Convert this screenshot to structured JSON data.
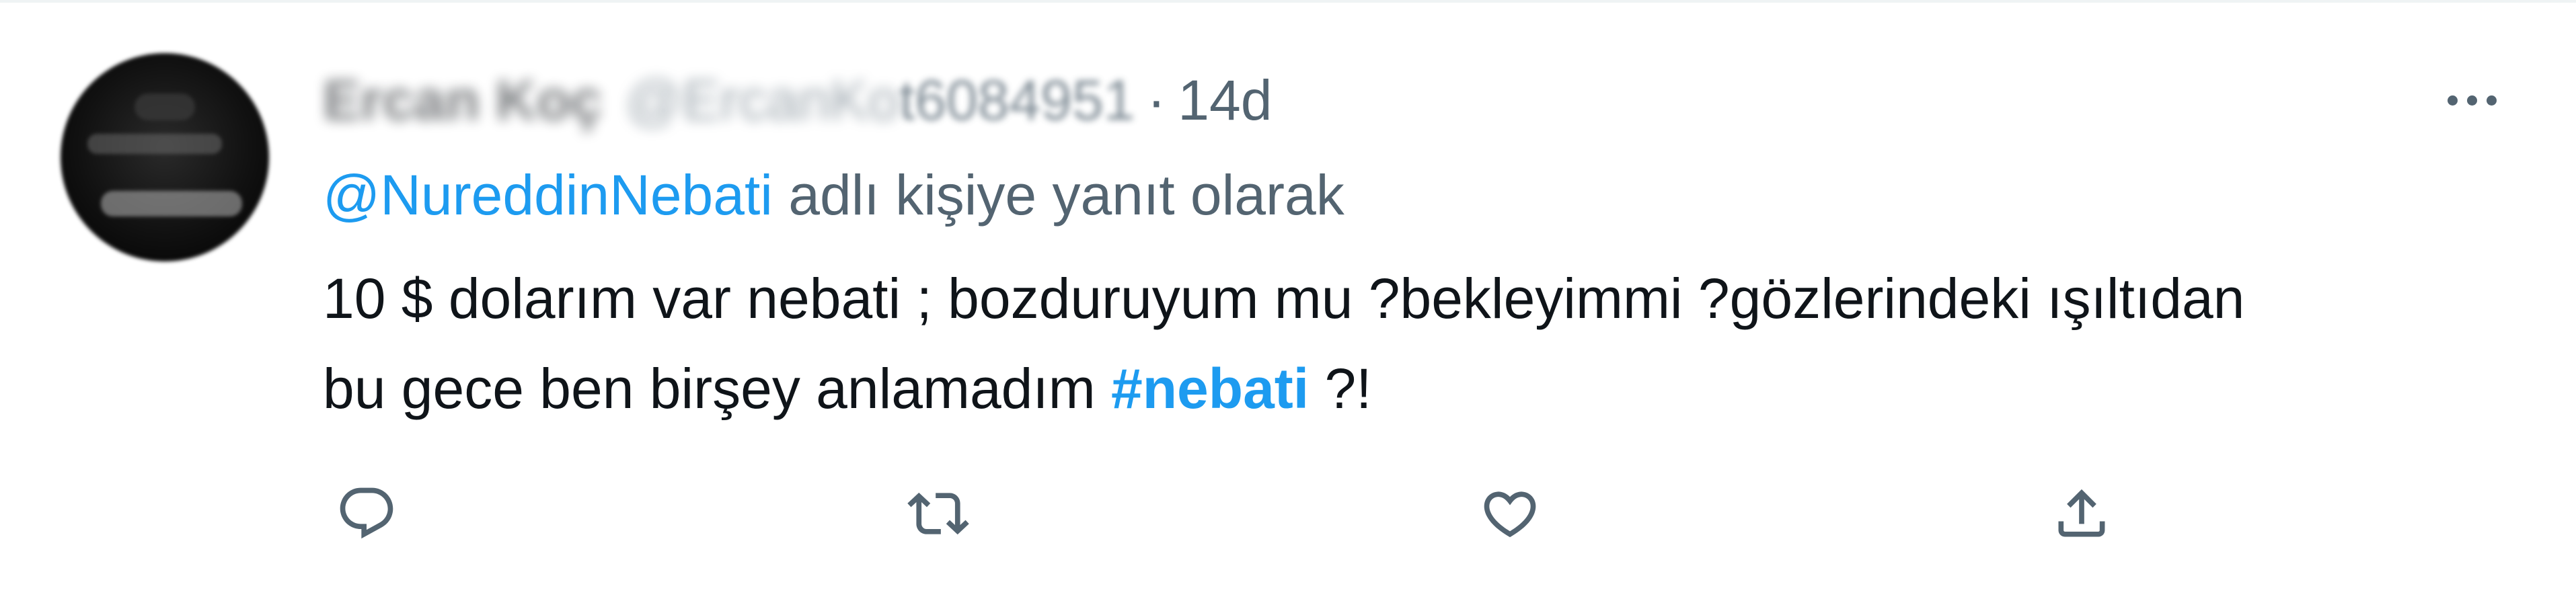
{
  "tweet": {
    "author_name": "Ercan Koç",
    "author_handle_prefix": "@ErcanKo",
    "author_handle_suffix": "t6084951",
    "separator": "·",
    "timestamp": "14d",
    "reply_to_handle": "@NureddinNebati",
    "reply_to_suffix": " adlı kişiye yanıt olarak",
    "text_line1": "10 $ dolarım var nebati ; bozduruyum mu ?bekleyimmi ?gözlerindeki ışıltıdan",
    "text_line2_before": "bu gece ben birşey anlamadım ",
    "hashtag": "#nebati",
    "text_line2_after": " ?!"
  },
  "actions": [
    {
      "name": "reply",
      "icon": "reply-icon"
    },
    {
      "name": "retweet",
      "icon": "retweet-icon"
    },
    {
      "name": "like",
      "icon": "like-icon"
    },
    {
      "name": "share",
      "icon": "share-icon"
    }
  ],
  "colors": {
    "text": "#0f1419",
    "secondary": "#536471",
    "accent": "#1d9bf0"
  }
}
